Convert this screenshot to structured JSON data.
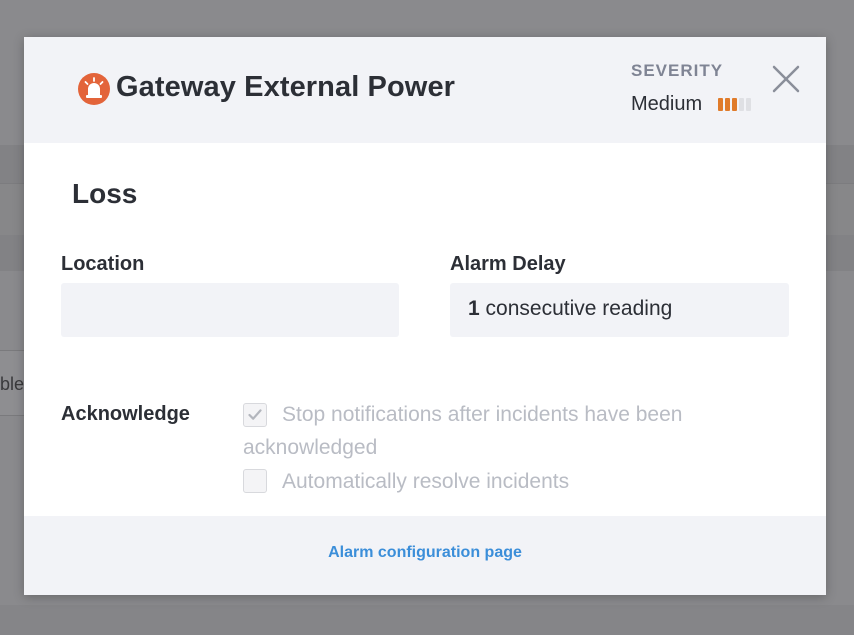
{
  "background": {
    "partial_text": "ble"
  },
  "modal": {
    "title": "Gateway External Power",
    "subtitle": "Loss",
    "severity": {
      "label": "SEVERITY",
      "value": "Medium",
      "level": 3,
      "max_level": 5,
      "color_active": "#e07b2a",
      "color_inactive": "#dfe0e4"
    },
    "icon": "alarm-light-icon",
    "icon_color": "#e3643a",
    "close_icon": "close-icon",
    "location": {
      "label": "Location",
      "value": ""
    },
    "alarm_delay": {
      "label": "Alarm Delay",
      "count": "1",
      "unit": "consecutive reading"
    },
    "acknowledge": {
      "label": "Acknowledge",
      "options": [
        {
          "text_line1": "Stop notifications after incidents have been",
          "text_line2": "acknowledged",
          "checked": true
        },
        {
          "text_line1": "Automatically resolve incidents",
          "checked": false
        }
      ]
    },
    "footer": {
      "link": "Alarm configuration page",
      "link_color": "#3b8ed9"
    }
  }
}
